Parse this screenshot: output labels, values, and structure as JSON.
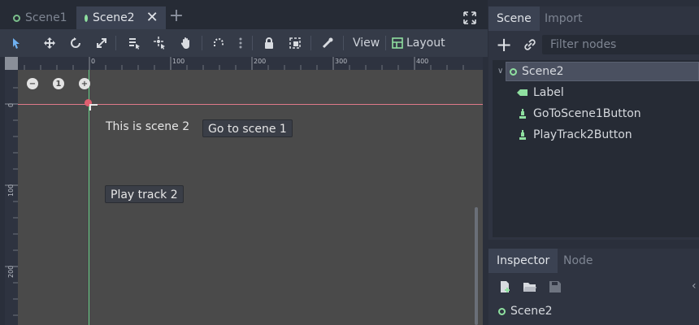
{
  "tabs": [
    {
      "label": "Scene1",
      "active": false
    },
    {
      "label": "Scene2",
      "active": true
    }
  ],
  "toolbar": {
    "view_label": "View",
    "layout_label": "Layout"
  },
  "rulers": {
    "top_labels": [
      "0",
      "100",
      "200",
      "300",
      "400"
    ],
    "left_labels": [
      "0",
      "100",
      "200"
    ]
  },
  "zoom": {
    "minus": "−",
    "reset": "1",
    "plus": "+"
  },
  "canvas": {
    "label_text": "This is scene 2",
    "goto_button": "Go to scene 1",
    "play_button": "Play track 2"
  },
  "scene_dock": {
    "tabs": [
      "Scene",
      "Import"
    ],
    "filter_placeholder": "Filter nodes",
    "tree": [
      {
        "label": "Scene2",
        "icon": "node-circle-icon",
        "depth": 0
      },
      {
        "label": "Label",
        "icon": "label-tag-icon",
        "depth": 1
      },
      {
        "label": "GoToScene1Button",
        "icon": "button-icon",
        "depth": 1
      },
      {
        "label": "PlayTrack2Button",
        "icon": "button-icon",
        "depth": 1
      }
    ]
  },
  "inspector_dock": {
    "tabs": [
      "Inspector",
      "Node"
    ],
    "object_label": "Scene2"
  },
  "colors": {
    "accent_green": "#8fe0a0",
    "guide_pink": "#e07a8a",
    "guide_green": "#6ad08a"
  }
}
